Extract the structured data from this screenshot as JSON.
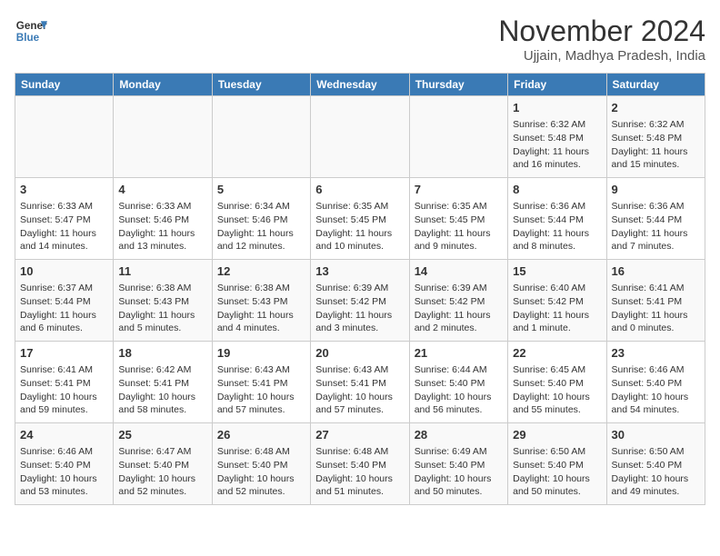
{
  "header": {
    "logo_line1": "General",
    "logo_line2": "Blue",
    "month": "November 2024",
    "location": "Ujjain, Madhya Pradesh, India"
  },
  "weekdays": [
    "Sunday",
    "Monday",
    "Tuesday",
    "Wednesday",
    "Thursday",
    "Friday",
    "Saturday"
  ],
  "weeks": [
    [
      {
        "day": "",
        "info": ""
      },
      {
        "day": "",
        "info": ""
      },
      {
        "day": "",
        "info": ""
      },
      {
        "day": "",
        "info": ""
      },
      {
        "day": "",
        "info": ""
      },
      {
        "day": "1",
        "info": "Sunrise: 6:32 AM\nSunset: 5:48 PM\nDaylight: 11 hours and 16 minutes."
      },
      {
        "day": "2",
        "info": "Sunrise: 6:32 AM\nSunset: 5:48 PM\nDaylight: 11 hours and 15 minutes."
      }
    ],
    [
      {
        "day": "3",
        "info": "Sunrise: 6:33 AM\nSunset: 5:47 PM\nDaylight: 11 hours and 14 minutes."
      },
      {
        "day": "4",
        "info": "Sunrise: 6:33 AM\nSunset: 5:46 PM\nDaylight: 11 hours and 13 minutes."
      },
      {
        "day": "5",
        "info": "Sunrise: 6:34 AM\nSunset: 5:46 PM\nDaylight: 11 hours and 12 minutes."
      },
      {
        "day": "6",
        "info": "Sunrise: 6:35 AM\nSunset: 5:45 PM\nDaylight: 11 hours and 10 minutes."
      },
      {
        "day": "7",
        "info": "Sunrise: 6:35 AM\nSunset: 5:45 PM\nDaylight: 11 hours and 9 minutes."
      },
      {
        "day": "8",
        "info": "Sunrise: 6:36 AM\nSunset: 5:44 PM\nDaylight: 11 hours and 8 minutes."
      },
      {
        "day": "9",
        "info": "Sunrise: 6:36 AM\nSunset: 5:44 PM\nDaylight: 11 hours and 7 minutes."
      }
    ],
    [
      {
        "day": "10",
        "info": "Sunrise: 6:37 AM\nSunset: 5:44 PM\nDaylight: 11 hours and 6 minutes."
      },
      {
        "day": "11",
        "info": "Sunrise: 6:38 AM\nSunset: 5:43 PM\nDaylight: 11 hours and 5 minutes."
      },
      {
        "day": "12",
        "info": "Sunrise: 6:38 AM\nSunset: 5:43 PM\nDaylight: 11 hours and 4 minutes."
      },
      {
        "day": "13",
        "info": "Sunrise: 6:39 AM\nSunset: 5:42 PM\nDaylight: 11 hours and 3 minutes."
      },
      {
        "day": "14",
        "info": "Sunrise: 6:39 AM\nSunset: 5:42 PM\nDaylight: 11 hours and 2 minutes."
      },
      {
        "day": "15",
        "info": "Sunrise: 6:40 AM\nSunset: 5:42 PM\nDaylight: 11 hours and 1 minute."
      },
      {
        "day": "16",
        "info": "Sunrise: 6:41 AM\nSunset: 5:41 PM\nDaylight: 11 hours and 0 minutes."
      }
    ],
    [
      {
        "day": "17",
        "info": "Sunrise: 6:41 AM\nSunset: 5:41 PM\nDaylight: 10 hours and 59 minutes."
      },
      {
        "day": "18",
        "info": "Sunrise: 6:42 AM\nSunset: 5:41 PM\nDaylight: 10 hours and 58 minutes."
      },
      {
        "day": "19",
        "info": "Sunrise: 6:43 AM\nSunset: 5:41 PM\nDaylight: 10 hours and 57 minutes."
      },
      {
        "day": "20",
        "info": "Sunrise: 6:43 AM\nSunset: 5:41 PM\nDaylight: 10 hours and 57 minutes."
      },
      {
        "day": "21",
        "info": "Sunrise: 6:44 AM\nSunset: 5:40 PM\nDaylight: 10 hours and 56 minutes."
      },
      {
        "day": "22",
        "info": "Sunrise: 6:45 AM\nSunset: 5:40 PM\nDaylight: 10 hours and 55 minutes."
      },
      {
        "day": "23",
        "info": "Sunrise: 6:46 AM\nSunset: 5:40 PM\nDaylight: 10 hours and 54 minutes."
      }
    ],
    [
      {
        "day": "24",
        "info": "Sunrise: 6:46 AM\nSunset: 5:40 PM\nDaylight: 10 hours and 53 minutes."
      },
      {
        "day": "25",
        "info": "Sunrise: 6:47 AM\nSunset: 5:40 PM\nDaylight: 10 hours and 52 minutes."
      },
      {
        "day": "26",
        "info": "Sunrise: 6:48 AM\nSunset: 5:40 PM\nDaylight: 10 hours and 52 minutes."
      },
      {
        "day": "27",
        "info": "Sunrise: 6:48 AM\nSunset: 5:40 PM\nDaylight: 10 hours and 51 minutes."
      },
      {
        "day": "28",
        "info": "Sunrise: 6:49 AM\nSunset: 5:40 PM\nDaylight: 10 hours and 50 minutes."
      },
      {
        "day": "29",
        "info": "Sunrise: 6:50 AM\nSunset: 5:40 PM\nDaylight: 10 hours and 50 minutes."
      },
      {
        "day": "30",
        "info": "Sunrise: 6:50 AM\nSunset: 5:40 PM\nDaylight: 10 hours and 49 minutes."
      }
    ]
  ]
}
